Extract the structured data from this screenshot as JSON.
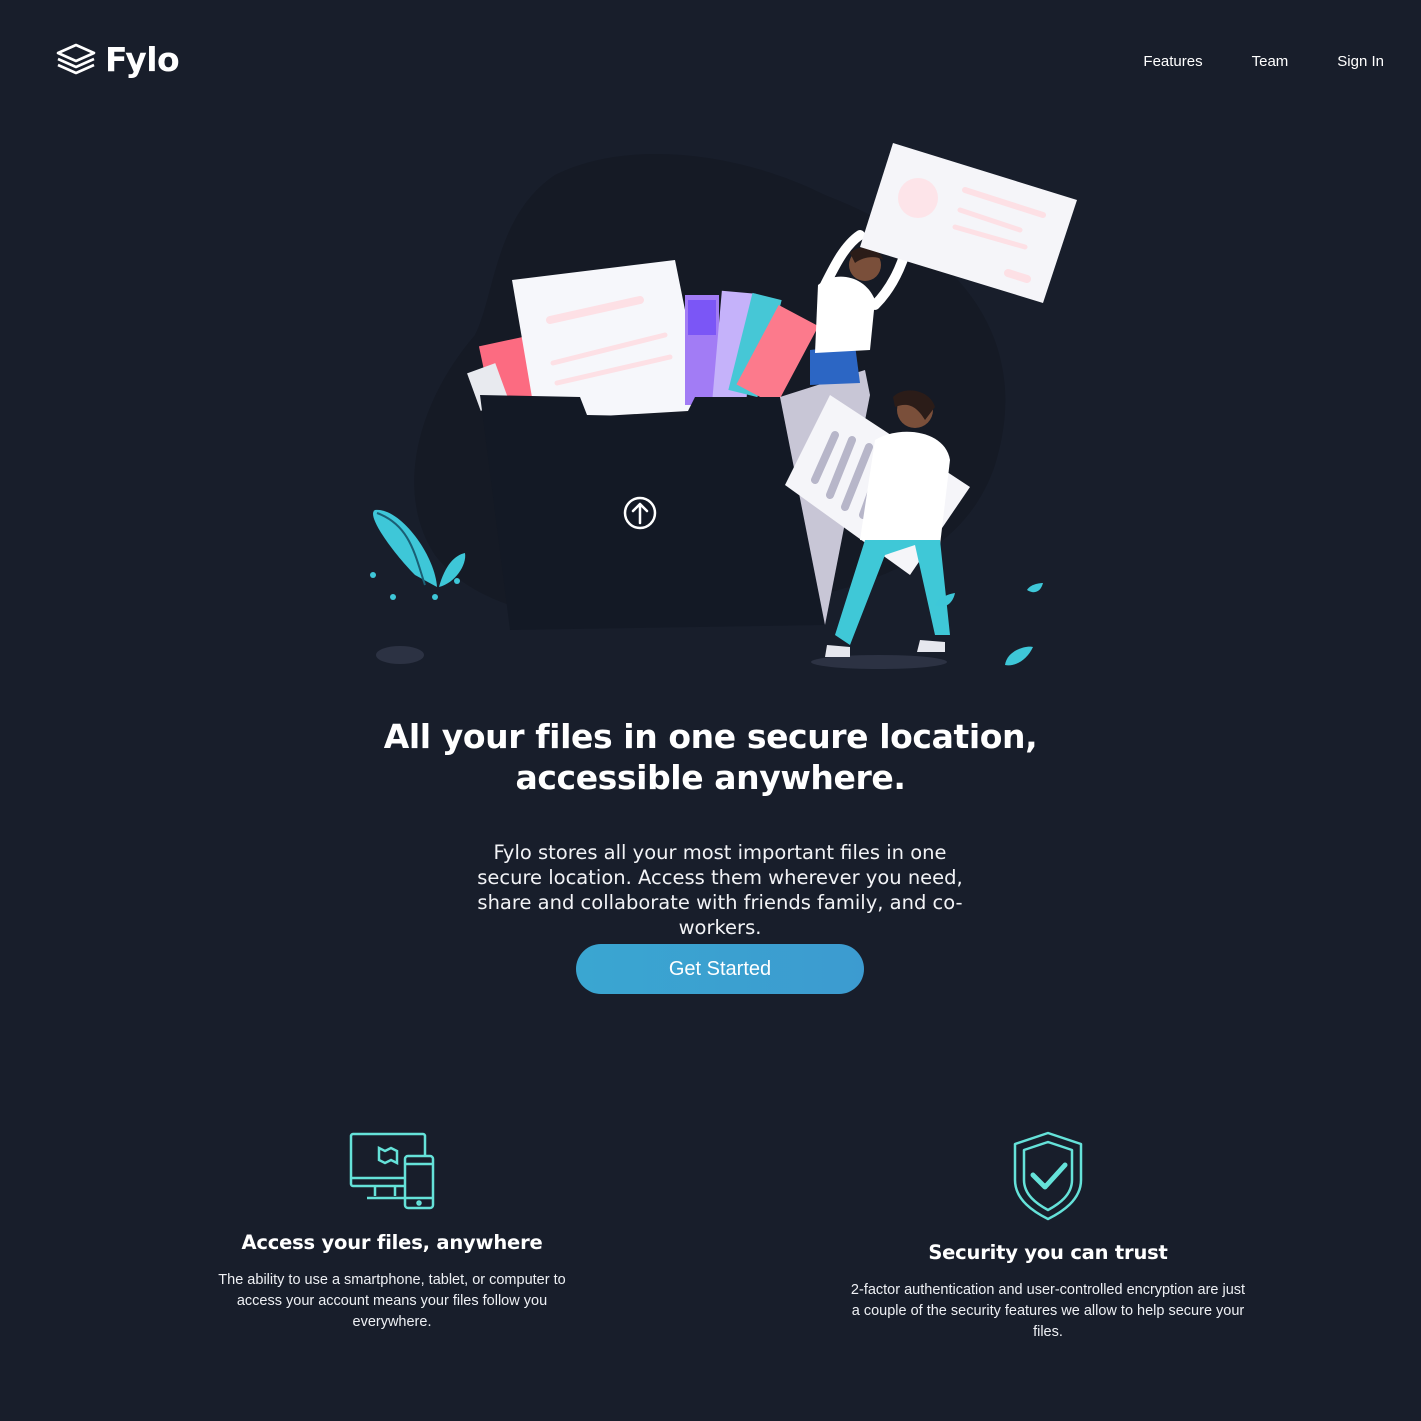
{
  "header": {
    "brand": "Fylo",
    "nav": [
      "Features",
      "Team",
      "Sign In"
    ]
  },
  "hero": {
    "title_line1": "All your files in one secure location,",
    "title_line2": "accessible anywhere.",
    "description": "Fylo stores all your most important files in one secure location. Access them wherever you need, share and collaborate with friends family, and co-workers.",
    "cta_label": "Get Started"
  },
  "features": [
    {
      "icon": "devices-icon",
      "title": "Access your files, anywhere",
      "text": "The ability to use a smartphone, tablet, or computer to access your account means your files follow you everywhere."
    },
    {
      "icon": "shield-check-icon",
      "title": "Security you can trust",
      "text": "2-factor authentication and user-controlled encryption are just a couple of the security features we allow to help secure your files."
    }
  ],
  "colors": {
    "background": "#181e2b",
    "accent": "#3ba5d1",
    "teal": "#65e2d9"
  }
}
